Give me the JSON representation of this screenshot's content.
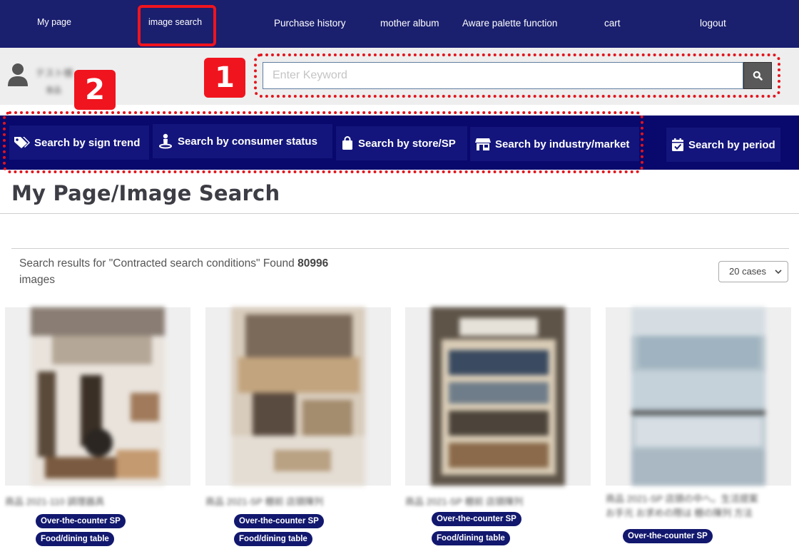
{
  "nav": {
    "items": [
      "My page",
      "image search",
      "Purchase history",
      "mother album",
      "Aware palette function",
      "cart",
      "logout"
    ]
  },
  "user": {
    "name_blurred": "テスト様",
    "sub_blurred": "食品"
  },
  "callouts": {
    "one": "1",
    "two": "2"
  },
  "search": {
    "placeholder": "Enter Keyword",
    "button_icon": "search-icon"
  },
  "categories": [
    {
      "label": "Search by sign trend",
      "icon": "tag-icon"
    },
    {
      "label": "Search by consumer status",
      "icon": "person-icon"
    },
    {
      "label": "Search by store/SP",
      "icon": "shopping-bag-icon"
    },
    {
      "label": "Search by industry/market",
      "icon": "store-icon"
    },
    {
      "label": "Search by period",
      "icon": "calendar-check-icon"
    }
  ],
  "page": {
    "title": "My Page/Image Search"
  },
  "results": {
    "prefix": "Search results for \"Contracted search conditions\" Found",
    "count": "80996",
    "suffix": "images",
    "per_page": "20 cases"
  },
  "cards": [
    {
      "caption": "商品 2021-110 調理器具",
      "tags": [
        "Over-the-counter SP",
        "Food/dining table"
      ]
    },
    {
      "caption": "商品 2021-SP 棚前 店頭陳列",
      "tags": [
        "Over-the-counter SP",
        "Food/dining table"
      ]
    },
    {
      "caption": "商品 2021-SP 棚前 店頭陳列",
      "tags": [
        "Over-the-counter SP",
        "Food/dining table"
      ]
    },
    {
      "caption": "商品 2021-SP 店頭の中へ。生活提案",
      "caption2": "お手元 お求めの際は 棚の陳列 方法",
      "tags": [
        "Over-the-counter SP"
      ]
    }
  ]
}
